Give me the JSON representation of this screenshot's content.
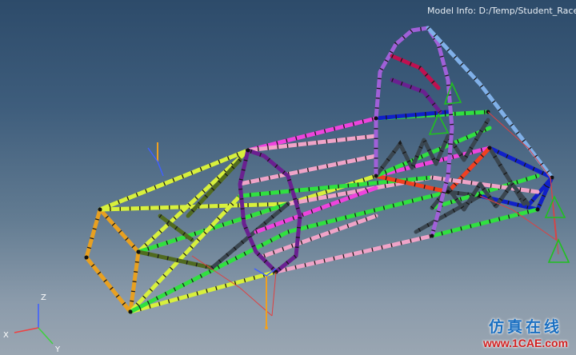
{
  "header": {
    "model_info": "Model Info: D:/Temp/Student_Race_Car"
  },
  "triad": {
    "x_label": "X",
    "y_label": "Y",
    "z_label": "Z"
  },
  "watermark": {
    "cn_text": "仿真在线",
    "url_text": "www.1CAE.com"
  },
  "colors": {
    "yellow_green": "#d8f03c",
    "magenta": "#ee44dd",
    "pink": "#f0a4c8",
    "green": "#30e040",
    "purple": "#a060d8",
    "dark_purple": "#6a2090",
    "orange": "#e8a020",
    "olive": "#506a20",
    "dark_gray": "#3a4650",
    "blue": "#1020c8",
    "light_blue": "#80b0e8",
    "red": "#f04020",
    "crimson": "#c01050",
    "constraint_green": "#20c020",
    "spring_red": "#e04040",
    "axis_blue": "#4060ff",
    "axis_orange": "#f0a020"
  }
}
